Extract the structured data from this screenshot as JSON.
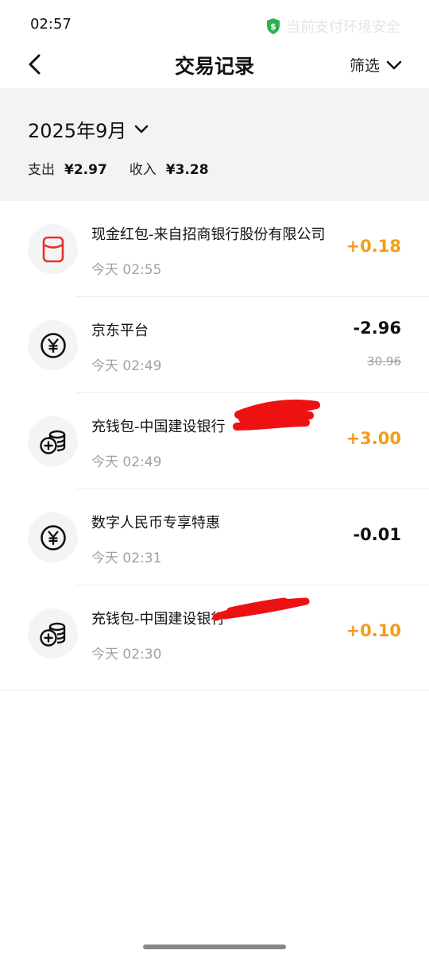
{
  "status_bar": {
    "time": "02:57",
    "security_text": "当前支付环境安全"
  },
  "nav": {
    "title": "交易记录",
    "filter_label": "筛选"
  },
  "summary": {
    "month": "2025年9月",
    "expense_label": "支出",
    "expense_value": "¥2.97",
    "income_label": "收入",
    "income_value": "¥3.28"
  },
  "transactions": [
    {
      "icon": "red-packet-icon",
      "title": "现金红包-来自招商银行股份有限公司",
      "time": "今天 02:55",
      "amount": "+0.18",
      "direction": "income"
    },
    {
      "icon": "yuan-coin-icon",
      "title": "京东平台",
      "time": "今天 02:49",
      "amount": "-2.96",
      "original_amount": "30.96",
      "direction": "expense"
    },
    {
      "icon": "coin-stack-plus-icon",
      "title": "充钱包-中国建设银行",
      "time": "今天 02:49",
      "amount": "+3.00",
      "direction": "income"
    },
    {
      "icon": "yuan-coin-icon",
      "title": "数字人民币专享特惠",
      "time": "今天 02:31",
      "amount": "-0.01",
      "direction": "expense"
    },
    {
      "icon": "coin-stack-plus-icon",
      "title": "充钱包-中国建设银行",
      "time": "今天 02:30",
      "amount": "+0.10",
      "direction": "income"
    }
  ],
  "colors": {
    "income": "#f39c1a",
    "expense": "#111111",
    "shield": "#2bb24c",
    "red_packet": "#e8322b",
    "redaction": "#ee1111"
  }
}
